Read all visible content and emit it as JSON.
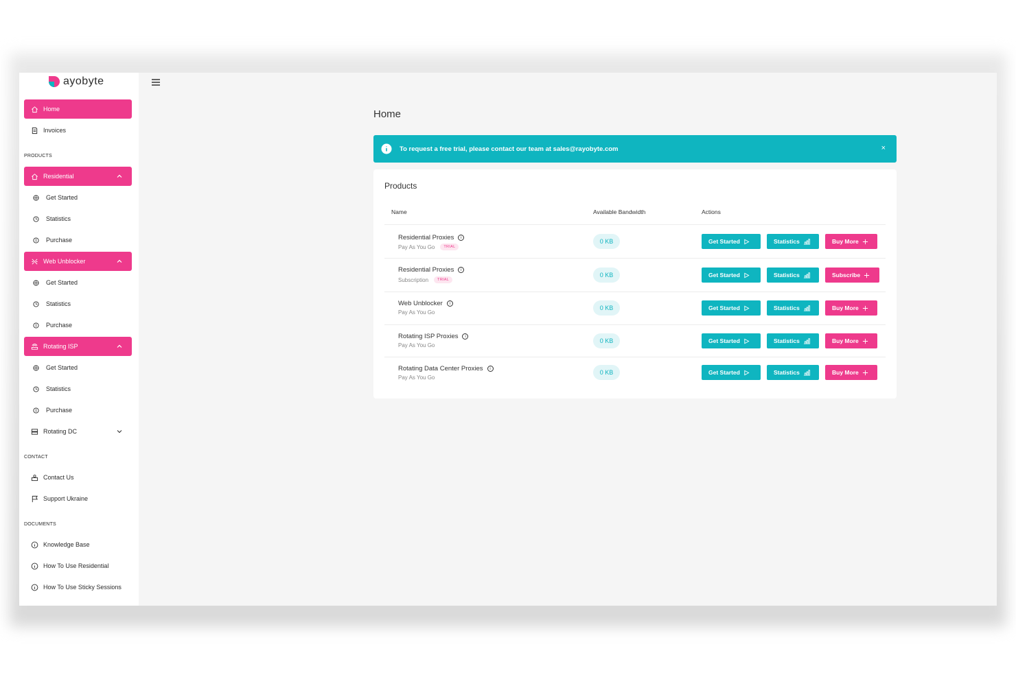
{
  "brand": {
    "name": "ayobyte"
  },
  "sidebar": {
    "top_items": [
      {
        "label": "Home",
        "icon": "home-icon",
        "active": true
      },
      {
        "label": "Invoices",
        "icon": "invoice-icon",
        "active": false
      }
    ],
    "sections": {
      "products": "PRODUCTS",
      "contact": "CONTACT",
      "documents": "DOCUMENTS"
    },
    "groups": [
      {
        "label": "Residential",
        "icon": "house-icon",
        "expanded": true,
        "items": [
          {
            "label": "Get Started"
          },
          {
            "label": "Statistics"
          },
          {
            "label": "Purchase"
          }
        ]
      },
      {
        "label": "Web Unblocker",
        "icon": "unblock-icon",
        "expanded": true,
        "items": [
          {
            "label": "Get Started"
          },
          {
            "label": "Statistics"
          },
          {
            "label": "Purchase"
          }
        ]
      },
      {
        "label": "Rotating ISP",
        "icon": "router-icon",
        "expanded": true,
        "items": [
          {
            "label": "Get Started"
          },
          {
            "label": "Statistics"
          },
          {
            "label": "Purchase"
          }
        ]
      },
      {
        "label": "Rotating DC",
        "icon": "server-icon",
        "expanded": false,
        "items": []
      }
    ],
    "contact_items": [
      {
        "label": "Contact Us",
        "icon": "contact-icon"
      },
      {
        "label": "Support Ukraine",
        "icon": "flag-icon"
      }
    ],
    "document_items": [
      {
        "label": "Knowledge Base",
        "icon": "info-icon"
      },
      {
        "label": "How To Use Residential",
        "icon": "info-icon"
      },
      {
        "label": "How To Use Sticky Sessions",
        "icon": "info-icon"
      }
    ]
  },
  "main": {
    "title": "Home",
    "alert": {
      "text": "To request a free trial, please contact our team at sales@rayobyte.com",
      "close": "×"
    },
    "products_card": {
      "title": "Products",
      "columns": {
        "name": "Name",
        "bandwidth": "Available Bandwidth",
        "actions": "Actions"
      },
      "rows": [
        {
          "name": "Residential Proxies",
          "plan": "Pay As You Go",
          "badge": "TRIAL",
          "bandwidth": "0 KB",
          "btn1": "Get Started",
          "btn2": "Statistics",
          "btn3": "Buy More"
        },
        {
          "name": "Residential Proxies",
          "plan": "Subscription",
          "badge": "TRIAL",
          "bandwidth": "0 KB",
          "btn1": "Get Started",
          "btn2": "Statistics",
          "btn3": "Subscribe"
        },
        {
          "name": "Web Unblocker",
          "plan": "Pay As You Go",
          "badge": "",
          "bandwidth": "0 KB",
          "btn1": "Get Started",
          "btn2": "Statistics",
          "btn3": "Buy More"
        },
        {
          "name": "Rotating ISP Proxies",
          "plan": "Pay As You Go",
          "badge": "",
          "bandwidth": "0 KB",
          "btn1": "Get Started",
          "btn2": "Statistics",
          "btn3": "Buy More"
        },
        {
          "name": "Rotating Data Center Proxies",
          "plan": "Pay As You Go",
          "badge": "",
          "bandwidth": "0 KB",
          "btn1": "Get Started",
          "btn2": "Statistics",
          "btn3": "Buy More"
        }
      ]
    }
  },
  "colors": {
    "pink": "#ee3a8c",
    "teal": "#0fb5c0"
  }
}
